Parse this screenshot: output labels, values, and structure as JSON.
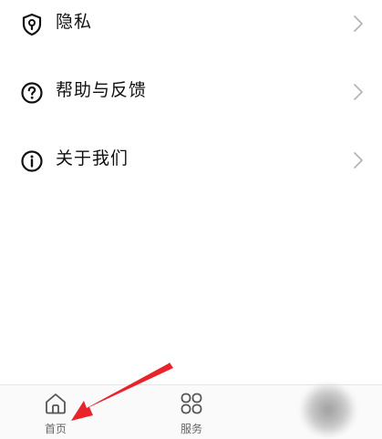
{
  "menu": {
    "items": [
      {
        "label": "隐私",
        "icon": "shield-keyhole-icon"
      },
      {
        "label": "帮助与反馈",
        "icon": "question-circle-icon"
      },
      {
        "label": "关于我们",
        "icon": "info-circle-icon"
      }
    ]
  },
  "tabbar": {
    "tabs": [
      {
        "label": "首页",
        "icon": "home-icon",
        "active": true
      },
      {
        "label": "服务",
        "icon": "grid-icon",
        "active": false
      }
    ]
  },
  "colors": {
    "text": "#111111",
    "chevron": "#b5b5b5",
    "tab_label": "#666666",
    "annotation_arrow": "#e8232a"
  }
}
